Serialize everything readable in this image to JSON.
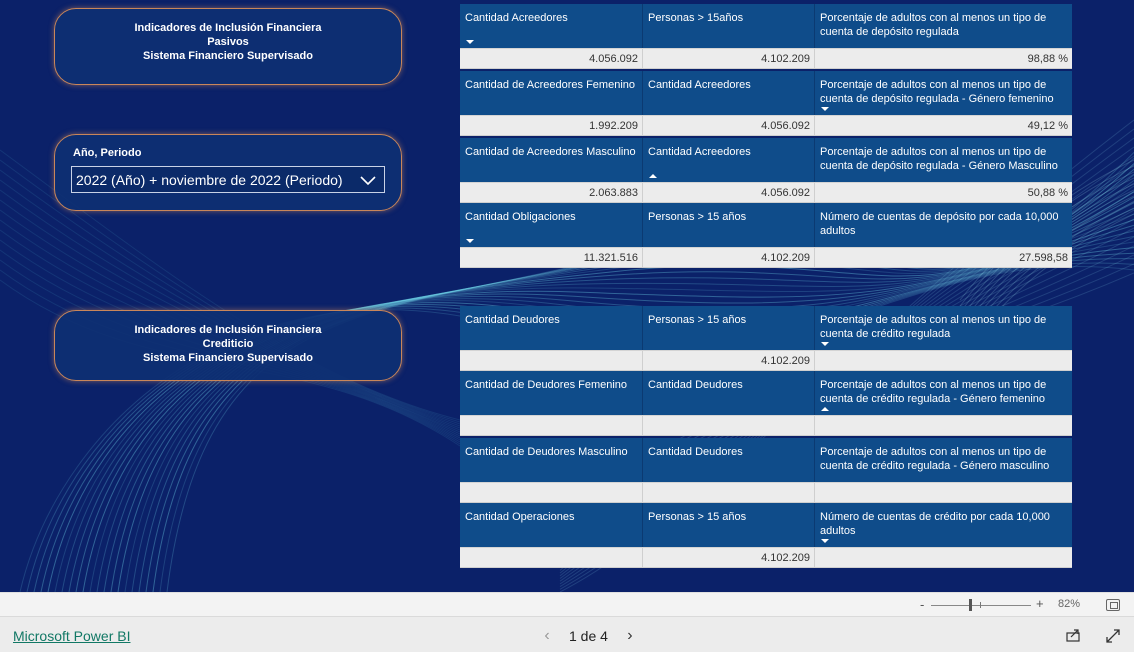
{
  "section_pasivos": {
    "line1": "Indicadores de Inclusión Financiera",
    "line2": "Pasivos",
    "line3": "Sistema Financiero Supervisado"
  },
  "slicer": {
    "label": "Año, Periodo",
    "value": "2022 (Año) + noviembre de 2022 (Periodo)",
    "icon": "chevron-down-icon"
  },
  "section_credito": {
    "line1": "Indicadores de Inclusión Financiera",
    "line2": "Crediticio",
    "line3": "Sistema Financiero Supervisado"
  },
  "tables_pasivos": [
    {
      "h1": "Cantidad Acreedores",
      "h2": "Personas > 15años",
      "h3": "Porcentaje de adultos con al menos un tipo de cuenta de depósito regulada",
      "v1": "4.056.092",
      "v2": "4.102.209",
      "v3": "98,88 %"
    },
    {
      "h1": "Cantidad de Acreedores Femenino",
      "h2": "Cantidad Acreedores",
      "h3": "Porcentaje de adultos con al menos un tipo de cuenta de depósito regulada - Género femenino",
      "v1": "1.992.209",
      "v2": "4.056.092",
      "v3": "49,12 %"
    },
    {
      "h1": "Cantidad de Acreedores Masculino",
      "h2": "Cantidad Acreedores",
      "h3": "Porcentaje de adultos con al menos un tipo de cuenta de depósito regulada - Género Masculino",
      "v1": "2.063.883",
      "v2": "4.056.092",
      "v3": "50,88 %"
    },
    {
      "h1": "Cantidad Obligaciones",
      "h2": "Personas > 15 años",
      "h3": "Número de cuentas de depósito por cada 10,000 adultos",
      "v1": "11.321.516",
      "v2": "4.102.209",
      "v3": "27.598,58"
    }
  ],
  "tables_credito": [
    {
      "h1": "Cantidad Deudores",
      "h2": "Personas > 15 años",
      "h3": "Porcentaje de adultos con al menos un tipo de cuenta de crédito regulada",
      "v1": "",
      "v2": "4.102.209",
      "v3": ""
    },
    {
      "h1": "Cantidad de Deudores Femenino",
      "h2": "Cantidad Deudores",
      "h3": "Porcentaje de adultos con al menos un tipo de cuenta de crédito regulada - Género femenino",
      "v1": "",
      "v2": "",
      "v3": ""
    },
    {
      "h1": "Cantidad de Deudores Masculino",
      "h2": "Cantidad Deudores",
      "h3": "Porcentaje de adultos con al menos un tipo de cuenta de crédito regulada - Género masculino",
      "v1": "",
      "v2": "",
      "v3": ""
    },
    {
      "h1": "Cantidad Operaciones",
      "h2": "Personas > 15 años",
      "h3": "Número de cuentas de crédito por cada 10,000 adultos",
      "v1": "",
      "v2": "4.102.209",
      "v3": ""
    }
  ],
  "zoom": {
    "minus": "-",
    "plus": "+",
    "level": "82%"
  },
  "footer": {
    "brand": "Microsoft Power BI",
    "page_text": "1 de 4",
    "prev": "‹",
    "next": "›"
  },
  "colors": {
    "background": "#0b2169",
    "header": "#0f4c8a",
    "card_border": "#c9865a",
    "brand_link": "#117865"
  }
}
